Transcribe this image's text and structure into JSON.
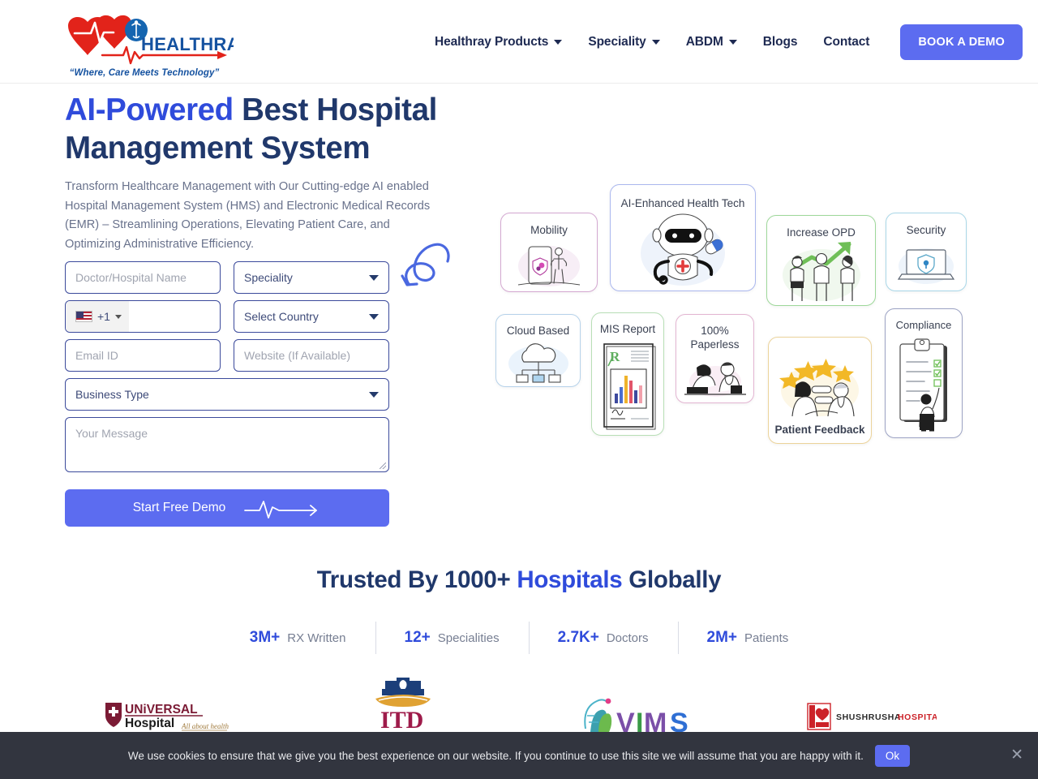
{
  "header": {
    "logo": {
      "name": "HEALTHRAY",
      "tagline": "“Where, Care Meets Technology”"
    },
    "nav": [
      {
        "label": "Healthray Products",
        "has_dropdown": true
      },
      {
        "label": "Speciality",
        "has_dropdown": true
      },
      {
        "label": "ABDM",
        "has_dropdown": true
      },
      {
        "label": "Blogs",
        "has_dropdown": false
      },
      {
        "label": "Contact",
        "has_dropdown": false
      }
    ],
    "cta_label": "BOOK A DEMO"
  },
  "hero": {
    "title_accent": "AI-Powered",
    "title_rest": " Best Hospital Management System",
    "description": "Transform Healthcare Management with Our Cutting-edge AI enabled Hospital Management System (HMS) and Electronic Medical Records (EMR) – Streamlining Operations, Elevating Patient Care, and Optimizing Administrative Efficiency."
  },
  "form": {
    "name_placeholder": "Doctor/Hospital Name",
    "speciality_selected": "Speciality",
    "phone_country_code": "+1",
    "phone_placeholder": "",
    "country_selected": "Select Country",
    "email_placeholder": "Email ID",
    "website_placeholder": "Website (If Available)",
    "business_type_selected": "Business Type",
    "message_placeholder": "Your Message",
    "submit_label": "Start Free Demo"
  },
  "feature_cards": [
    {
      "id": "mobility",
      "label": "Mobility",
      "border_color": "#d4a8d1"
    },
    {
      "id": "ai",
      "label": "AI-Enhanced Health Tech",
      "border_color": "#aab7ee"
    },
    {
      "id": "opd",
      "label": "Increase OPD",
      "border_color": "#9ed89a"
    },
    {
      "id": "security",
      "label": "Security",
      "border_color": "#a9d7e8"
    },
    {
      "id": "cloud",
      "label": "Cloud Based",
      "border_color": "#b6d2ea"
    },
    {
      "id": "mis",
      "label": "MIS Report",
      "border_color": "#b8dfb6"
    },
    {
      "id": "paperless",
      "label": "100% Paperless",
      "border_color": "#e3b5d2"
    },
    {
      "id": "feedback",
      "label": "Patient Feedback",
      "border_color": "#ecd39a"
    },
    {
      "id": "compliance",
      "label": "Compliance",
      "border_color": "#9ca3c4"
    }
  ],
  "trusted": {
    "title_pre": "Trusted By 1000+ ",
    "title_accent": "Hospitals",
    "title_post": " Globally",
    "stats": [
      {
        "num": "3M+",
        "label": "RX Written"
      },
      {
        "num": "12+",
        "label": "Specialities"
      },
      {
        "num": "2.7K+",
        "label": "Doctors"
      },
      {
        "num": "2M+",
        "label": "Patients"
      }
    ]
  },
  "partners": [
    {
      "id": "universal",
      "name": "UNiVERSAL Hospital",
      "tagline": "All about health"
    },
    {
      "id": "itd",
      "name": "ITD"
    },
    {
      "id": "vims",
      "name": "VIMS"
    },
    {
      "id": "shushrusha",
      "name": "SHUSHRUSHA HOSPITAL"
    }
  ],
  "cookie": {
    "text": "We use cookies to ensure that we give you the best experience on our website. If you continue to use this site we will assume that you are happy with it.",
    "ok_label": "Ok",
    "close_label": "✕"
  },
  "colors": {
    "primary_blue": "#2f4bdb",
    "dark_navy": "#20386b",
    "accent_purple": "#5c6cf0",
    "muted_text": "#69728c",
    "cookie_bg": "#32353f"
  }
}
